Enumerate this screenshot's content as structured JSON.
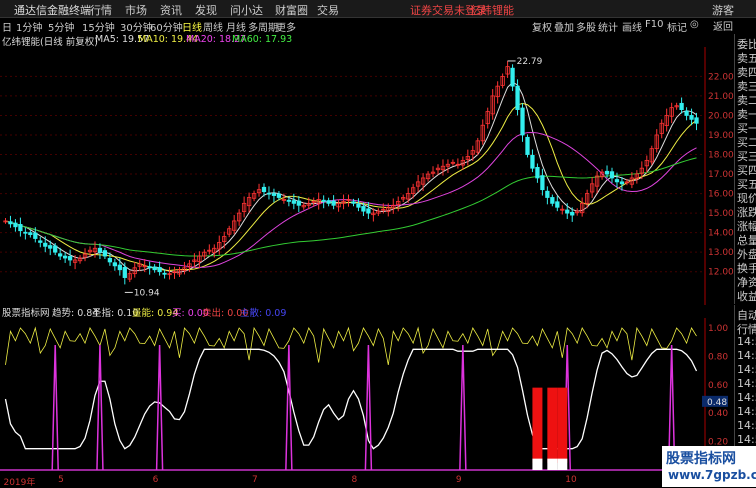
{
  "topbar": {
    "app": "通达信金融终端",
    "menu": [
      "行情",
      "市场",
      "资讯",
      "发现",
      "问小达",
      "财富圈",
      "交易"
    ],
    "promo1": "证券交易未登录",
    "promo2": "亿纬锂能",
    "guest": "游客"
  },
  "toolbar": {
    "periods": [
      "日",
      "1分钟",
      "5分钟",
      "15分钟",
      "30分钟",
      "60分钟",
      "日线",
      "周线",
      "月线",
      "多周期",
      "更多"
    ],
    "tools": [
      "复权",
      "叠加",
      "多股",
      "统计",
      "画线",
      "F10",
      "标记",
      "◎"
    ]
  },
  "chart_info": {
    "title": "亿纬锂能(日线 前复权)",
    "ma5": "MA5: 19.57",
    "ma10": "MA10: 19.44",
    "ma20": "MA20: 18.27",
    "ma60": "MA60: 17.93"
  },
  "right_panel": {
    "labels": [
      "委比",
      "卖五",
      "卖四",
      "卖三",
      "卖二",
      "卖一",
      "买一",
      "买二",
      "买三",
      "买四",
      "买五",
      "现价",
      "涨跌",
      "涨幅",
      "总量",
      "外盘",
      "换手",
      "净资",
      "收益"
    ],
    "lower": [
      "自动",
      "行情",
      "14:56",
      "14:56",
      "14:56",
      "14:56",
      "14:56",
      "14:56",
      "14:56",
      "14:56",
      "14:56",
      "14:56"
    ],
    "back": "返回"
  },
  "indicator": {
    "name": "股票指标网",
    "trend": "趋势: 0.84",
    "holy": "圣指: 0.10",
    "power": "量能: 0.94",
    "buy": "买: 0.00",
    "sell": "卖出: 0.00",
    "main": "主散: 0.09",
    "current_label": "0.48"
  },
  "watermark": {
    "line1": "股票指标网",
    "line2": "www.7gpzb.com"
  },
  "chart_data": {
    "type": "candlestick",
    "title": "亿纬锂能(日线 前复权)",
    "price_axis": {
      "min": 10.5,
      "max": 23.3,
      "ticks": [
        12.0,
        13.0,
        14.0,
        15.0,
        16.0,
        17.0,
        18.0,
        19.0,
        20.0,
        21.0,
        22.0
      ]
    },
    "annotations": [
      {
        "label": "22.79",
        "index": 101,
        "value": 22.79
      },
      {
        "label": "10.94",
        "index": 24,
        "value": 10.94
      }
    ],
    "x_labels": [
      "2019年",
      "5",
      "6",
      "7",
      "8",
      "9",
      "10",
      "11"
    ],
    "x_label_index": [
      0,
      11,
      30,
      50,
      70,
      91,
      113,
      137
    ],
    "candles_count": 140,
    "closes": [
      14.6,
      14.45,
      14.3,
      14.1,
      14.0,
      13.9,
      13.7,
      13.5,
      13.3,
      13.2,
      13.0,
      12.8,
      12.7,
      12.6,
      12.6,
      12.7,
      12.9,
      13.1,
      13.2,
      13.0,
      12.8,
      12.5,
      12.3,
      12.1,
      11.7,
      11.9,
      12.2,
      12.4,
      12.3,
      12.2,
      12.1,
      12.0,
      11.9,
      11.9,
      12.0,
      12.1,
      12.2,
      12.4,
      12.6,
      12.8,
      13.0,
      13.1,
      13.2,
      13.5,
      13.8,
      14.2,
      14.6,
      15.0,
      15.5,
      15.8,
      16.0,
      16.2,
      16.1,
      16.0,
      15.9,
      15.8,
      15.7,
      15.6,
      15.5,
      15.4,
      15.4,
      15.5,
      15.6,
      15.7,
      15.6,
      15.5,
      15.4,
      15.5,
      15.6,
      15.7,
      15.5,
      15.3,
      15.1,
      15.0,
      15.0,
      15.1,
      15.2,
      15.3,
      15.4,
      15.6,
      15.8,
      16.0,
      16.3,
      16.6,
      16.8,
      17.0,
      17.1,
      17.3,
      17.4,
      17.5,
      17.6,
      17.5,
      17.7,
      17.9,
      18.2,
      18.7,
      19.5,
      20.2,
      21.0,
      21.5,
      22.0,
      22.5,
      21.5,
      20.3,
      19.0,
      18.0,
      17.3,
      16.8,
      16.2,
      15.8,
      15.5,
      15.3,
      15.2,
      15.0,
      14.9,
      15.1,
      15.5,
      16.0,
      16.5,
      16.9,
      17.1,
      17.0,
      16.8,
      16.6,
      16.5,
      16.6,
      16.8,
      17.0,
      17.3,
      17.7,
      18.3,
      19.0,
      19.6,
      20.0,
      20.4,
      20.5,
      20.3,
      20.0,
      19.8,
      19.6
    ],
    "indicator_axis": {
      "ticks": [
        1.0,
        0.8,
        0.6,
        0.4,
        0.2
      ]
    },
    "signal_spikes": [
      10,
      19,
      31,
      57,
      73,
      92,
      113,
      134
    ],
    "red_bars": [
      107,
      110,
      112
    ]
  }
}
